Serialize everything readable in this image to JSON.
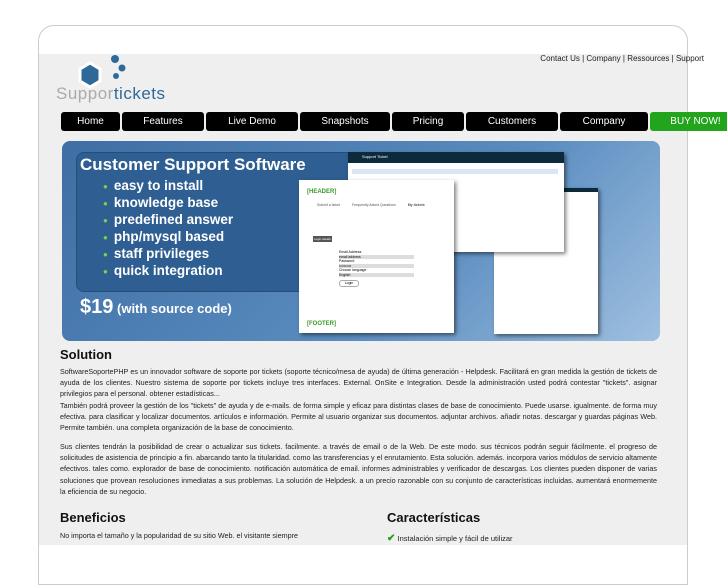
{
  "top_links": [
    "Contact Us",
    "Company",
    "Ressources",
    "Support"
  ],
  "logo": {
    "part1": "Suppor",
    "part2": "tickets"
  },
  "nav": [
    "Home",
    "Features",
    "Live Demo",
    "Snapshots",
    "Pricing",
    "Customers",
    "Company",
    "BUY NOW!"
  ],
  "colors": {
    "nav_bg": "#000000",
    "buy_bg": "#22a51d",
    "banner": "#3e6ea3",
    "check": "#2a9a1a"
  },
  "banner": {
    "title": "Customer Support Software",
    "items": [
      "easy to install",
      "knowledge base",
      "predefined answer",
      "php/mysql based",
      "staff privileges",
      "quick integration"
    ],
    "price": "$19",
    "price_note": "(with source code)",
    "shot": {
      "header": "[HEADER]",
      "footer": "[FOOTER]",
      "tabs": [
        "Submit a ticket",
        "Frequently Asked Questions",
        "My tickets"
      ],
      "login_label": "Login details",
      "email_label": "Email Address",
      "email_value": "email address",
      "password_label": "Password",
      "password_value": "••••••••••",
      "language_label": "Choose language",
      "language_value": "English",
      "login_button": "Login",
      "app_title": "Support Ticket"
    }
  },
  "solution": {
    "title": "Solution",
    "p1": "SoftwareSoportePHP es un innovador software de soporte por tickets (soporte técnico/mesa de ayuda) de última generación - Helpdesk. Facilitará en gran medida la gestión de tickets de ayuda de los clientes. Nuestro sistema de soporte por tickets incluye tres interfaces. External. OnSite e Integration. Desde la administración usted podrá contestar \"tickets\". asignar privilegios para el personal. obtener estadísticas...",
    "p2": "También podrá proveer la gestión de los \"tickets\" de ayuda y de e-mails. de forma simple y eficaz para distintas clases de base de conocimiento. Puede usarse. igualmente. de forma muy efectiva. para clasificar y localizar documentos. artículos e información. Permite al usuario organizar sus documentos. adjuntar archivos. añadir notas. descargar y guardas páginas Web. Permite también. una completa organización de la base de conocimiento.",
    "p3": "Sus clientes tendrán la posibilidad de crear o actualizar sus tickets. facilmente. a través de email o de la Web. De este modo. sus técnicos podrán seguir fácilmente. el progreso de solicitudes de asistencia de principio a fin. abarcando tanto la titularidad. como las transferencias y el enrutamiento. Esta solución. además. incorpora varios módulos de servicio altamente efectivos. tales como. explorador de base de conocimiento. notificación automática de email. informes administrables y verificador de descargas. Los clientes pueden disponer de varias soluciones que provean resoluciones inmediatas a sus problemas. La solución de Helpdesk. a un precio razonable con su conjunto de características incluidas. aumentará enormemente la eficiencia de su negocio."
  },
  "beneficios": {
    "title": "Beneficios",
    "text": "No importa el tamaño y la popularidad de su sitio Web. el visitante siempre"
  },
  "caracteristicas": {
    "title": "Características",
    "items": [
      "Instalación simple y fácil de utilizar"
    ]
  }
}
